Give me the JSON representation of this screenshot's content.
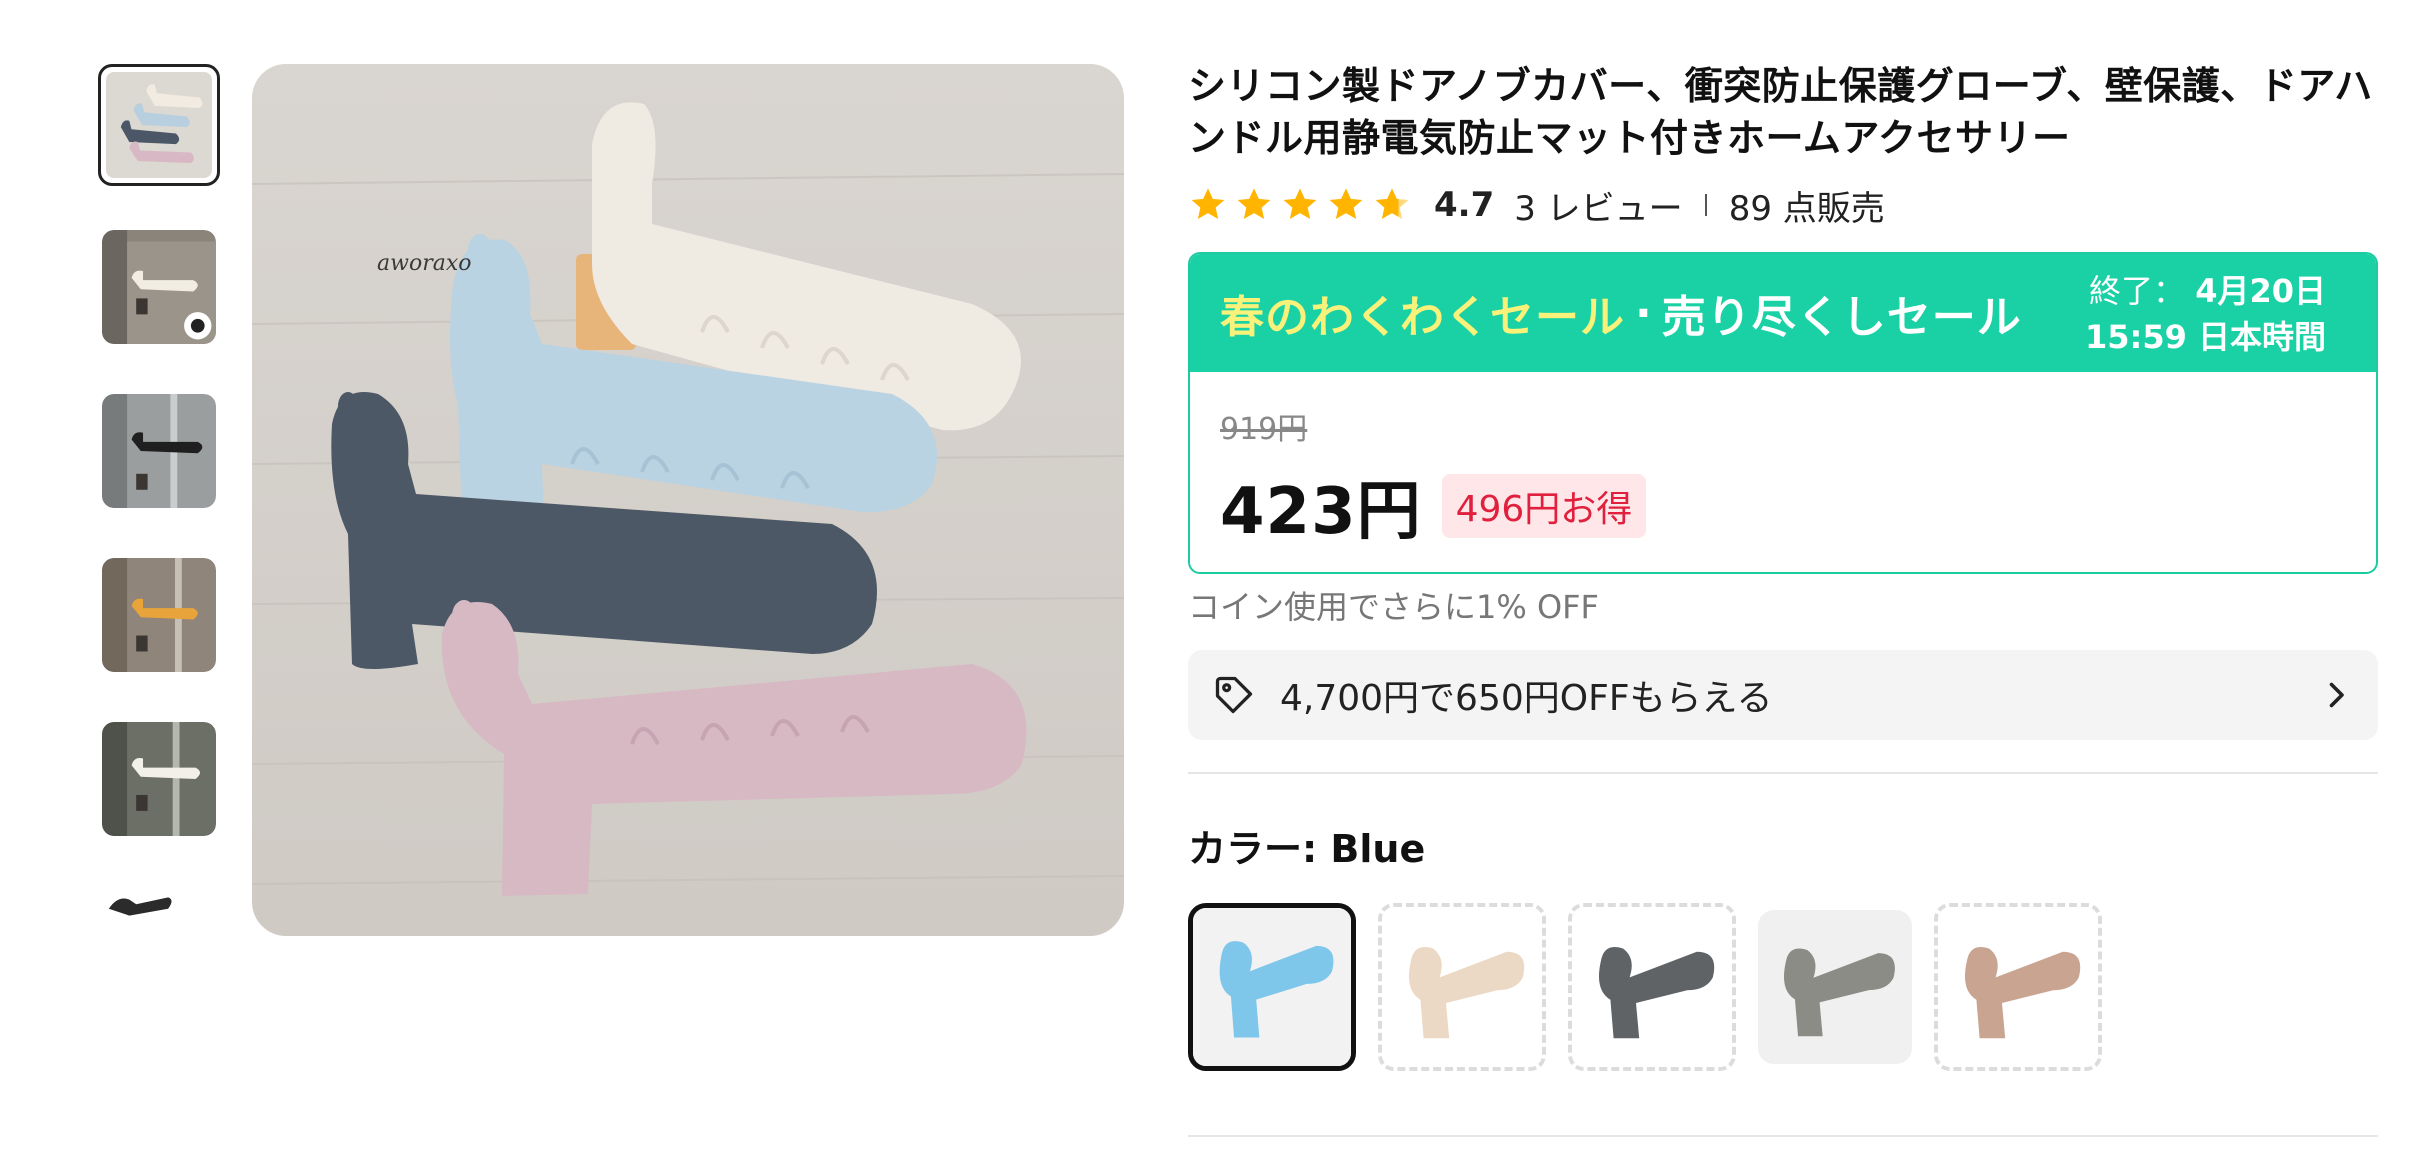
{
  "gallery": {
    "thumbnails": [
      {
        "name": "thumb-1",
        "active": true
      },
      {
        "name": "thumb-2",
        "active": false
      },
      {
        "name": "thumb-3",
        "active": false
      },
      {
        "name": "thumb-4",
        "active": false
      },
      {
        "name": "thumb-5",
        "active": false
      },
      {
        "name": "thumb-6",
        "active": false
      }
    ],
    "main_image_signature": "aworaxo"
  },
  "product": {
    "title": "シリコン製ドアノブカバー、衝突防止保護グローブ、壁保護、ドアハンドル用静電気防止マット付きホームアクセサリー",
    "rating": {
      "stars": 4.7,
      "score_label": "4.7",
      "reviews_label": "3 レビュー",
      "sold_label": "89 点販売"
    }
  },
  "sale": {
    "name": "春のわくわくセール",
    "dot": "·",
    "subtitle": "売り尽くしセール",
    "end_label": "終了：",
    "end_date": "4月20日",
    "end_time": "15:59 日本時間",
    "original_price": "919円",
    "price": "423円",
    "saving": "496円お得"
  },
  "coin_note": "コイン使用でさらに1% OFF",
  "coupon": {
    "text": "4,700円で650円OFFもらえる",
    "icon": "tag-icon"
  },
  "color": {
    "label": "カラー: Blue",
    "options": [
      {
        "name": "Blue",
        "state": "selected",
        "color": "#7ec6ea"
      },
      {
        "name": "Beige",
        "state": "unavailable",
        "color": "#ecd9c5"
      },
      {
        "name": "Dark Gray",
        "state": "unavailable",
        "color": "#5f6366"
      },
      {
        "name": "Gray",
        "state": "available",
        "color": "#8c8c87"
      },
      {
        "name": "Pink Brown",
        "state": "unavailable",
        "color": "#c9a591"
      }
    ]
  },
  "colors": {
    "accent": "#1ad1a5",
    "sale_yellow": "#f9f27a",
    "saving_red": "#e0203d",
    "saving_bg": "#ffe6e8"
  }
}
